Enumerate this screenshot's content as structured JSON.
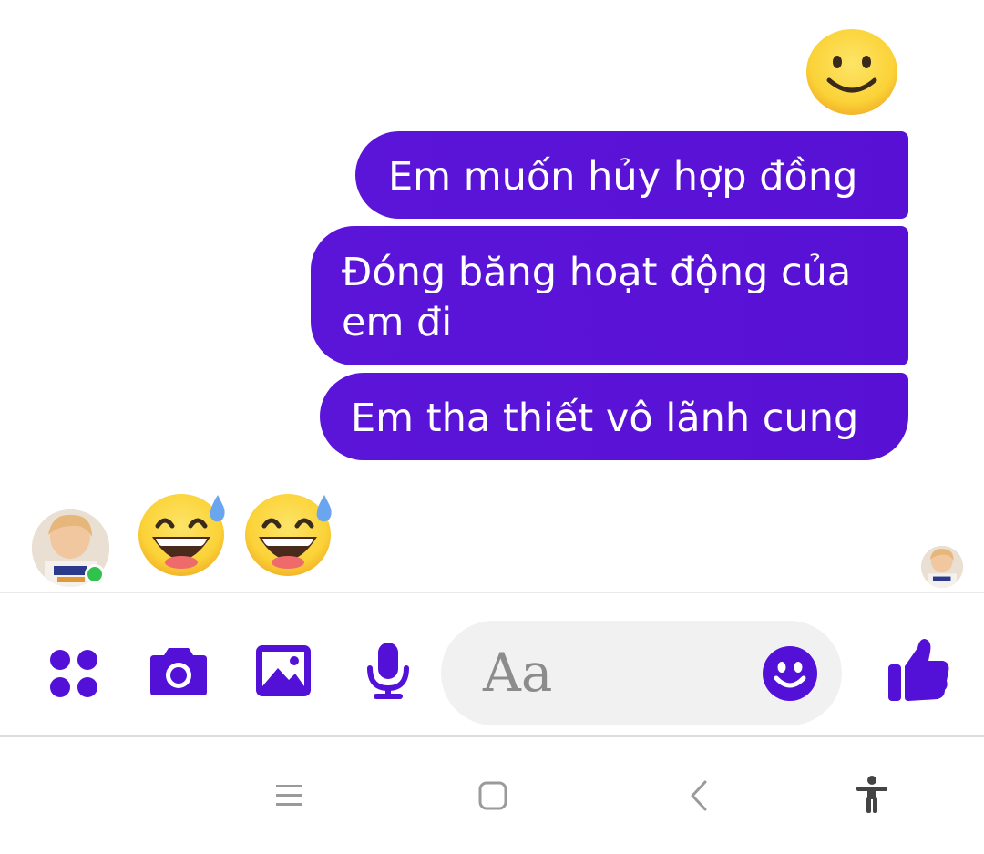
{
  "messages": {
    "sent": [
      "Em muốn hủy hợp đồng",
      "Đóng băng hoạt động của em đi",
      "Em tha thiết vô lãnh cung"
    ],
    "sent_emoji": "slightly-smiling-face",
    "received_emojis": [
      "grinning-face-with-sweat",
      "grinning-face-with-sweat"
    ]
  },
  "composer": {
    "placeholder": "Aa",
    "icons": [
      "apps-icon",
      "camera-icon",
      "gallery-icon",
      "microphone-icon",
      "emoji-icon",
      "thumbs-up-icon"
    ]
  },
  "colors": {
    "accent": "#5311d8",
    "bubble": "#5b15d9",
    "online": "#31c24c",
    "input_bg": "#f1f1f1"
  },
  "navbar": {
    "icons": [
      "recent-apps-icon",
      "home-icon",
      "back-icon",
      "accessibility-icon"
    ]
  }
}
